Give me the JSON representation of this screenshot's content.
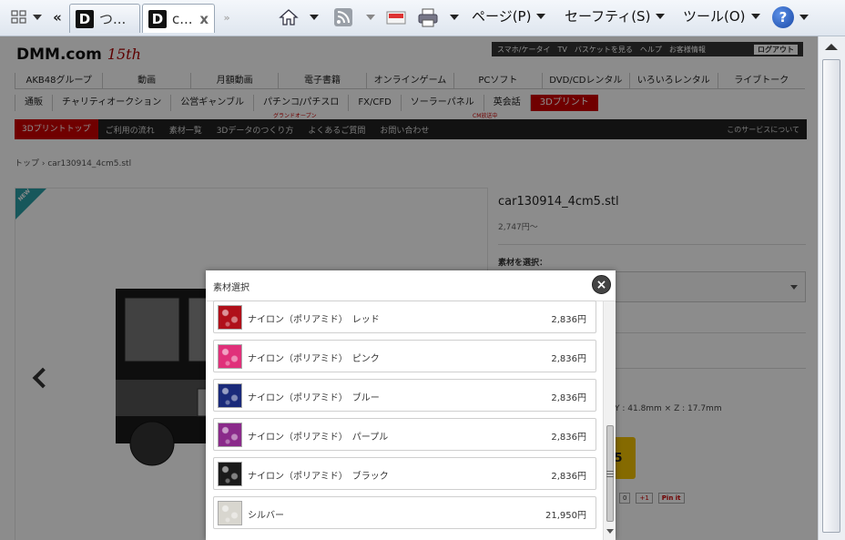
{
  "browser": {
    "tabs": [
      {
        "label": "つ..."
      },
      {
        "label": "c...",
        "close": "x"
      }
    ],
    "back_nav": "«",
    "more_tabs": "»",
    "menus": [
      {
        "label": "ページ(P)"
      },
      {
        "label": "セーフティ(S)"
      },
      {
        "label": "ツール(O)"
      }
    ],
    "help_glyph": "?"
  },
  "site": {
    "logo": "DMM.com",
    "logo_badge": "15th",
    "topbar": [
      "スマホ/ケータイ",
      "TV",
      "バスケットを見る",
      "ヘルプ",
      "お客様情報"
    ],
    "login": "ログアウト",
    "nav1": [
      "AKB48グループ",
      "動画",
      "月額動画",
      "電子書籍",
      "オンラインゲーム",
      "PCソフト",
      "DVD/CDレンタル",
      "いろいろレンタル",
      "ライブトーク"
    ],
    "nav2": [
      "通販",
      "チャリティオークション",
      "公営ギャンブル",
      "パチンコ/パチスロ",
      "FX/CFD",
      "ソーラーパネル",
      "英会話",
      "3Dプリント"
    ],
    "nav2_sub1": "グランドオープン",
    "nav2_sub2": "CM放送中",
    "blackbar": [
      "3Dプリントトップ",
      "ご利用の流れ",
      "素材一覧",
      "3Dデータのつくり方",
      "よくあるご質問",
      "お問い合わせ"
    ],
    "about": "このサービスについて",
    "breadcrumb": "トップ  ›  car130914_4cm5.stl",
    "new_badge": "NEW"
  },
  "product": {
    "title": "car130914_4cm5.stl",
    "price": "2,747円〜",
    "material_label": "素材を選択：",
    "dimensions": "Y : 41.8mm  ×  Z : 17.7mm",
    "buy_glyph": "5",
    "social": [
      "0",
      "+1",
      "Pin it"
    ]
  },
  "modal": {
    "title": "素材選択",
    "close": "×",
    "items": [
      {
        "name": "ナイロン（ポリアミド）　レッド",
        "price": "2,836円",
        "swatch": "#b0101a"
      },
      {
        "name": "ナイロン（ポリアミド）　ピンク",
        "price": "2,836円",
        "swatch": "#e0307a"
      },
      {
        "name": "ナイロン（ポリアミド）　ブルー",
        "price": "2,836円",
        "swatch": "#1a2a7a"
      },
      {
        "name": "ナイロン（ポリアミド）　パープル",
        "price": "2,836円",
        "swatch": "#8a2a8a"
      },
      {
        "name": "ナイロン（ポリアミド）　ブラック",
        "price": "2,836円",
        "swatch": "#1a1a1a"
      },
      {
        "name": "シルバー",
        "price": "21,950円",
        "swatch": "#d8d6cf"
      }
    ]
  }
}
